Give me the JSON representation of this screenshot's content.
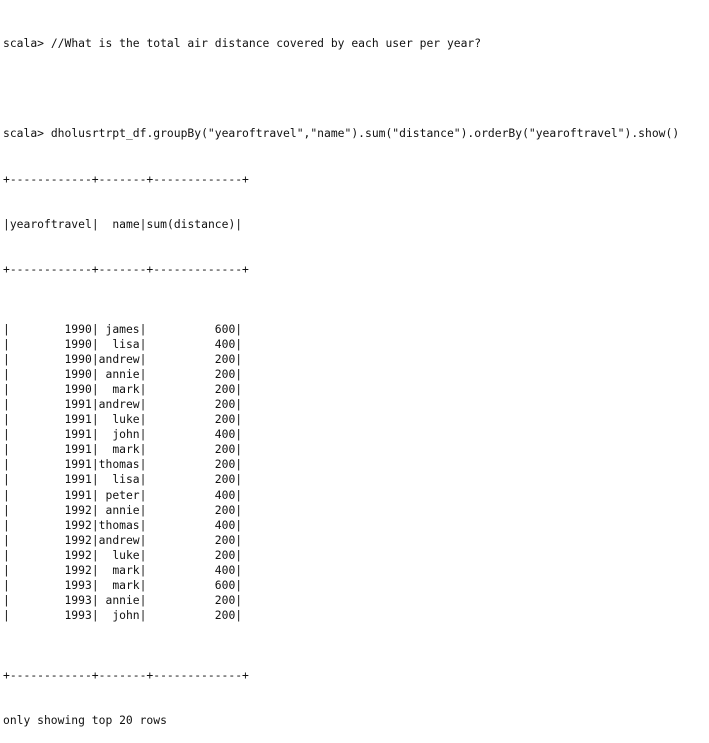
{
  "terminal": {
    "prompt": "scala>",
    "comment_command": "//What is the total air distance covered by each user per year?",
    "query_command": "dholusrtrpt_df.groupBy(\"yearoftravel\",\"name\").sum(\"distance\").orderBy(\"yearoftravel\").show()",
    "table": {
      "border": "+------------+-------+-------------+",
      "columns": [
        "yearoftravel",
        "name",
        "sum(distance)"
      ],
      "rows": [
        [
          "1990",
          "james",
          "600"
        ],
        [
          "1990",
          "lisa",
          "400"
        ],
        [
          "1990",
          "andrew",
          "200"
        ],
        [
          "1990",
          "annie",
          "200"
        ],
        [
          "1990",
          "mark",
          "200"
        ],
        [
          "1991",
          "andrew",
          "200"
        ],
        [
          "1991",
          "luke",
          "200"
        ],
        [
          "1991",
          "john",
          "400"
        ],
        [
          "1991",
          "mark",
          "200"
        ],
        [
          "1991",
          "thomas",
          "200"
        ],
        [
          "1991",
          "lisa",
          "200"
        ],
        [
          "1991",
          "peter",
          "400"
        ],
        [
          "1992",
          "annie",
          "200"
        ],
        [
          "1992",
          "thomas",
          "400"
        ],
        [
          "1992",
          "andrew",
          "200"
        ],
        [
          "1992",
          "luke",
          "200"
        ],
        [
          "1992",
          "mark",
          "400"
        ],
        [
          "1993",
          "mark",
          "600"
        ],
        [
          "1993",
          "annie",
          "200"
        ],
        [
          "1993",
          "john",
          "200"
        ]
      ]
    },
    "footer": "only showing top 20 rows"
  }
}
